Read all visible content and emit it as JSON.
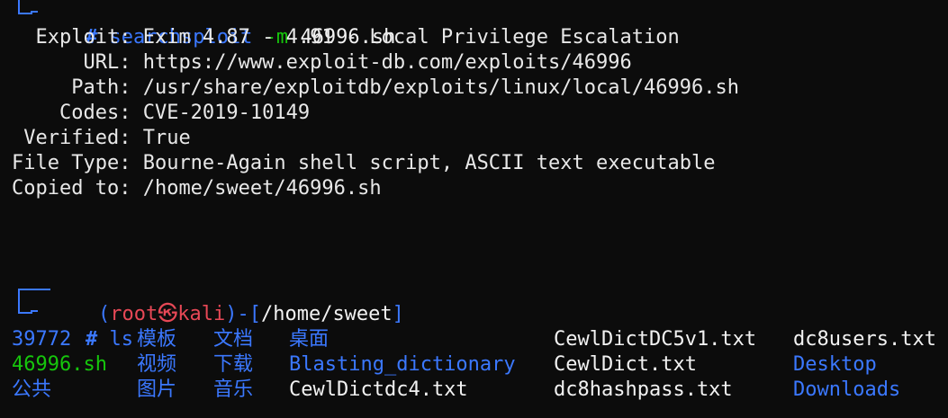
{
  "prompt_top": {
    "hash": "#",
    "command": "searchsploit",
    "flag": "-m",
    "argument": "46996.sh"
  },
  "exploit_info": [
    {
      "label": "  Exploit:",
      "value": "Exim 4.87 - 4.91 - Local Privilege Escalation"
    },
    {
      "label": "      URL:",
      "value": "https://www.exploit-db.com/exploits/46996"
    },
    {
      "label": "     Path:",
      "value": "/usr/share/exploitdb/exploits/linux/local/46996.sh"
    },
    {
      "label": "    Codes:",
      "value": "CVE-2019-10149"
    },
    {
      "label": " Verified:",
      "value": "True"
    },
    {
      "label": "File Type:",
      "value": "Bourne-Again shell script, ASCII text executable"
    },
    {
      "label": "Copied to:",
      "value": "/home/sweet/46996.sh"
    }
  ],
  "prompt_bottom": {
    "open_paren": "(",
    "user": "root",
    "at_symbol": "㉿",
    "host": "kali",
    "close_paren": ")",
    "dash": "-",
    "open_bracket": "[",
    "cwd": "/home/sweet",
    "close_bracket": "]",
    "hash": "#",
    "command": "ls"
  },
  "ls_output": [
    [
      "39772",
      "模板",
      "文档",
      "桌面",
      "CewlDictDC5v1.txt",
      "dc8users.txt"
    ],
    [
      "46996.sh",
      "视频",
      "下载",
      "Blasting_dictionary",
      "CewlDict.txt",
      "Desktop"
    ],
    [
      "公共",
      "图片",
      "音乐",
      "CewlDictdc4.txt",
      "dc8hashpass.txt",
      "Downloads"
    ]
  ],
  "colors": {
    "background": "#0c0c0c",
    "text": "#e8e8e8",
    "prompt_blue": "#3b78ff",
    "root_red": "#e74856",
    "exec_green": "#16c60c"
  }
}
